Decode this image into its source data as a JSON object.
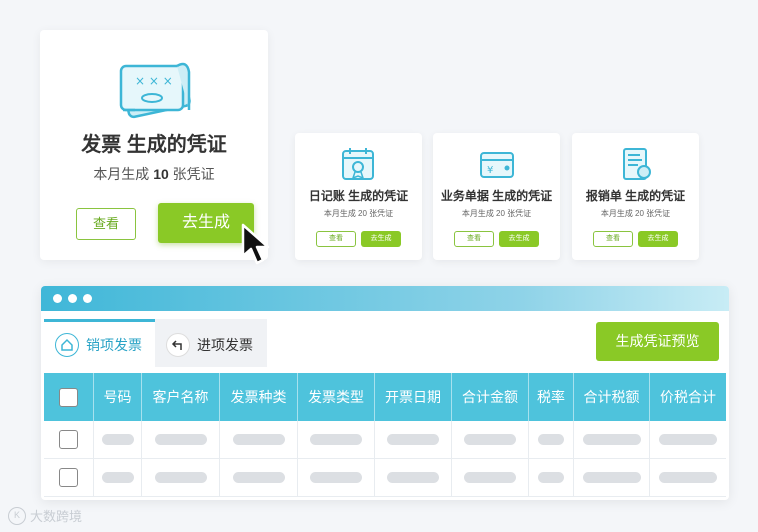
{
  "big_card": {
    "title": "发票 生成的凭证",
    "sub_prefix": "本月生成",
    "count": "10",
    "sub_suffix": "张凭证",
    "view_label": "查看",
    "generate_label": "去生成",
    "icon": "invoice-ticket-icon"
  },
  "small_cards": [
    {
      "title": "日记账 生成的凭证",
      "sub": "本月生成 20 张凭证",
      "view_label": "查看",
      "generate_label": "去生成",
      "icon": "calendar-journal-icon"
    },
    {
      "title": "业务单据 生成的凭证",
      "sub": "本月生成 20 张凭证",
      "view_label": "查看",
      "generate_label": "去生成",
      "icon": "wallet-yen-icon"
    },
    {
      "title": "报销单 生成的凭证",
      "sub": "本月生成 20 张凭证",
      "view_label": "查看",
      "generate_label": "去生成",
      "icon": "receipt-document-icon"
    }
  ],
  "window": {
    "tabs": [
      {
        "label": "销项发票",
        "icon": "home-outbound-icon",
        "active": true
      },
      {
        "label": "进项发票",
        "icon": "return-inbound-icon",
        "active": false
      }
    ],
    "preview_button": "生成凭证预览",
    "table": {
      "columns": [
        "号码",
        "客户名称",
        "发票种类",
        "发票类型",
        "开票日期",
        "合计金额",
        "税率",
        "合计税额",
        "价税合计"
      ],
      "row_count": 2
    }
  },
  "watermark": {
    "text": "大数跨境",
    "logo": "K"
  },
  "colors": {
    "accent_green": "#8ac926",
    "accent_blue": "#4ec3dc"
  }
}
